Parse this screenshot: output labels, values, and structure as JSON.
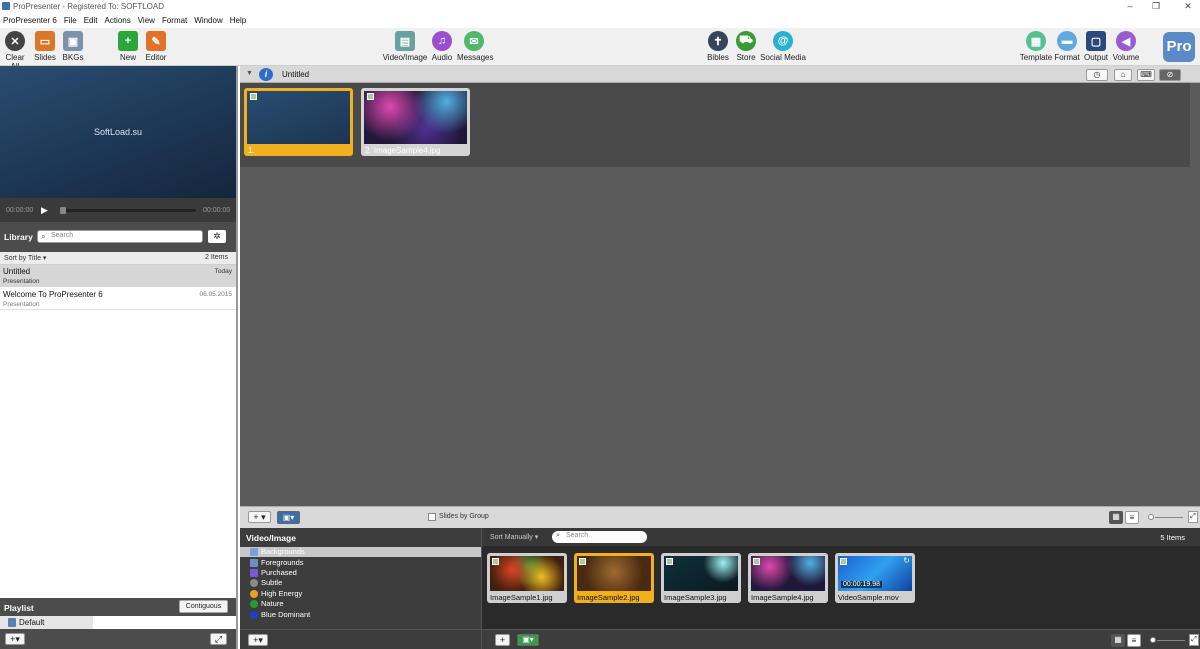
{
  "window": {
    "title": "ProPresenter - Registered To: SOFTLOAD"
  },
  "menu": [
    "ProPresenter 6",
    "File",
    "Edit",
    "Actions",
    "View",
    "Format",
    "Window",
    "Help"
  ],
  "toolbar": {
    "clear_all": "Clear All",
    "slides": "Slides",
    "bkgs": "BKGs",
    "new": "New",
    "editor": "Editor",
    "video_image": "Video/Image",
    "audio": "Audio",
    "messages": "Messages",
    "bibles": "Bibles",
    "store": "Store",
    "social_media": "Social Media",
    "template": "Template",
    "format": "Format",
    "output": "Output",
    "volume": "Volume",
    "pro_badge": "Pro"
  },
  "preview": {
    "text": "SoftLoad.su",
    "time_start": "00:00:00",
    "time_end": "00:00:00"
  },
  "library": {
    "label": "Library",
    "search_placeholder": "Search",
    "sort_label": "Sort by Title",
    "count": "2 Items",
    "items": [
      {
        "name": "Untitled",
        "subtitle": "Presentation",
        "date": "Today"
      },
      {
        "name": "Welcome To ProPresenter 6",
        "subtitle": "Presentation",
        "date": "06.05.2015"
      }
    ]
  },
  "playlist": {
    "label": "Playlist",
    "button": "Contiguous",
    "items": [
      "Default"
    ]
  },
  "document": {
    "title": "Untitled",
    "slides": [
      {
        "label": "1."
      },
      {
        "label": "2. ImageSample4.jpg"
      }
    ],
    "slides_by_group": "Slides by Group"
  },
  "media": {
    "header": "Video/Image",
    "categories": [
      {
        "name": "Backgrounds",
        "color": "#7aa0d8"
      },
      {
        "name": "Foregrounds",
        "color": "#6b8fc8"
      },
      {
        "name": "Purchased",
        "color": "#7a5ad0"
      },
      {
        "name": "Subtle",
        "color": "#8a8a8a"
      },
      {
        "name": "High Energy",
        "color": "#f0a020"
      },
      {
        "name": "Nature",
        "color": "#2a9a2a"
      },
      {
        "name": "Blue Dominant",
        "color": "#2040c0"
      }
    ],
    "sort": "Sort Manually",
    "search_placeholder": "Search",
    "count": "5 Items",
    "items": [
      {
        "name": "ImageSample1.jpg"
      },
      {
        "name": "ImageSample2.jpg"
      },
      {
        "name": "ImageSample3.jpg"
      },
      {
        "name": "ImageSample4.jpg"
      },
      {
        "name": "VideoSample.mov",
        "duration": "00:00:19.98"
      }
    ]
  }
}
